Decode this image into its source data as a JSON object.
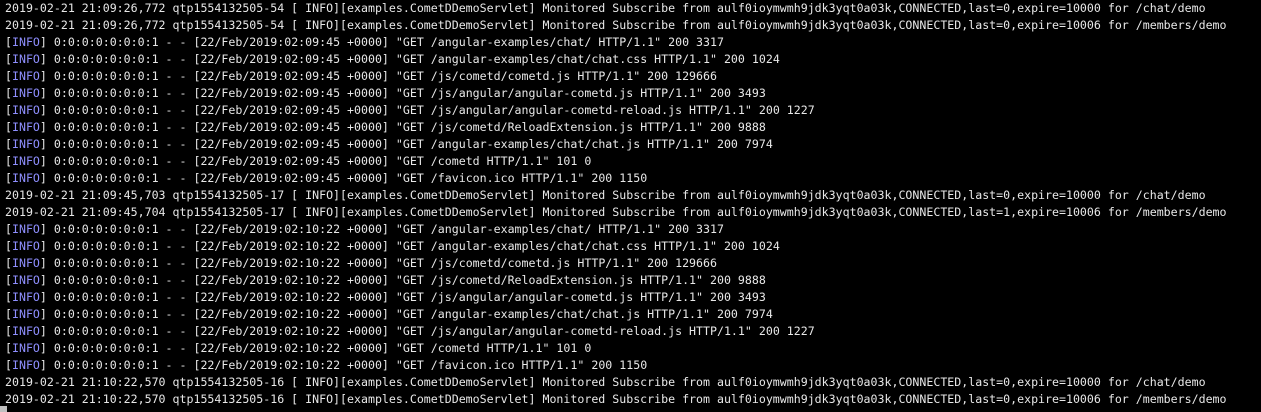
{
  "terminal": {
    "colors": {
      "background": "#000000",
      "text": "#e8e8e8",
      "info_tag": "#8f8fff"
    },
    "lines": [
      {
        "kind": "servlet",
        "text": "2019-02-21 21:09:26,772 qtp1554132505-54 [ INFO][examples.CometDDemoServlet] Monitored Subscribe from aulf0ioymwmh9jdk3yqt0a03k,CONNECTED,last=0,expire=10000 for /chat/demo"
      },
      {
        "kind": "servlet",
        "text": "2019-02-21 21:09:26,772 qtp1554132505-54 [ INFO][examples.CometDDemoServlet] Monitored Subscribe from aulf0ioymwmh9jdk3yqt0a03k,CONNECTED,last=0,expire=10006 for /members/demo"
      },
      {
        "kind": "access",
        "level": "INFO",
        "text": " 0:0:0:0:0:0:0:1 - - [22/Feb/2019:02:09:45 +0000] \"GET /angular-examples/chat/ HTTP/1.1\" 200 3317"
      },
      {
        "kind": "access",
        "level": "INFO",
        "text": " 0:0:0:0:0:0:0:1 - - [22/Feb/2019:02:09:45 +0000] \"GET /angular-examples/chat/chat.css HTTP/1.1\" 200 1024"
      },
      {
        "kind": "access",
        "level": "INFO",
        "text": " 0:0:0:0:0:0:0:1 - - [22/Feb/2019:02:09:45 +0000] \"GET /js/cometd/cometd.js HTTP/1.1\" 200 129666"
      },
      {
        "kind": "access",
        "level": "INFO",
        "text": " 0:0:0:0:0:0:0:1 - - [22/Feb/2019:02:09:45 +0000] \"GET /js/angular/angular-cometd.js HTTP/1.1\" 200 3493"
      },
      {
        "kind": "access",
        "level": "INFO",
        "text": " 0:0:0:0:0:0:0:1 - - [22/Feb/2019:02:09:45 +0000] \"GET /js/angular/angular-cometd-reload.js HTTP/1.1\" 200 1227"
      },
      {
        "kind": "access",
        "level": "INFO",
        "text": " 0:0:0:0:0:0:0:1 - - [22/Feb/2019:02:09:45 +0000] \"GET /js/cometd/ReloadExtension.js HTTP/1.1\" 200 9888"
      },
      {
        "kind": "access",
        "level": "INFO",
        "text": " 0:0:0:0:0:0:0:1 - - [22/Feb/2019:02:09:45 +0000] \"GET /angular-examples/chat/chat.js HTTP/1.1\" 200 7974"
      },
      {
        "kind": "access",
        "level": "INFO",
        "text": " 0:0:0:0:0:0:0:1 - - [22/Feb/2019:02:09:45 +0000] \"GET /cometd HTTP/1.1\" 101 0"
      },
      {
        "kind": "access",
        "level": "INFO",
        "text": " 0:0:0:0:0:0:0:1 - - [22/Feb/2019:02:09:45 +0000] \"GET /favicon.ico HTTP/1.1\" 200 1150"
      },
      {
        "kind": "servlet",
        "text": "2019-02-21 21:09:45,703 qtp1554132505-17 [ INFO][examples.CometDDemoServlet] Monitored Subscribe from aulf0ioymwmh9jdk3yqt0a03k,CONNECTED,last=0,expire=10000 for /chat/demo"
      },
      {
        "kind": "servlet",
        "text": "2019-02-21 21:09:45,704 qtp1554132505-17 [ INFO][examples.CometDDemoServlet] Monitored Subscribe from aulf0ioymwmh9jdk3yqt0a03k,CONNECTED,last=1,expire=10006 for /members/demo"
      },
      {
        "kind": "access",
        "level": "INFO",
        "text": " 0:0:0:0:0:0:0:1 - - [22/Feb/2019:02:10:22 +0000] \"GET /angular-examples/chat/ HTTP/1.1\" 200 3317"
      },
      {
        "kind": "access",
        "level": "INFO",
        "text": " 0:0:0:0:0:0:0:1 - - [22/Feb/2019:02:10:22 +0000] \"GET /angular-examples/chat/chat.css HTTP/1.1\" 200 1024"
      },
      {
        "kind": "access",
        "level": "INFO",
        "text": " 0:0:0:0:0:0:0:1 - - [22/Feb/2019:02:10:22 +0000] \"GET /js/cometd/cometd.js HTTP/1.1\" 200 129666"
      },
      {
        "kind": "access",
        "level": "INFO",
        "text": " 0:0:0:0:0:0:0:1 - - [22/Feb/2019:02:10:22 +0000] \"GET /js/cometd/ReloadExtension.js HTTP/1.1\" 200 9888"
      },
      {
        "kind": "access",
        "level": "INFO",
        "text": " 0:0:0:0:0:0:0:1 - - [22/Feb/2019:02:10:22 +0000] \"GET /js/angular/angular-cometd.js HTTP/1.1\" 200 3493"
      },
      {
        "kind": "access",
        "level": "INFO",
        "text": " 0:0:0:0:0:0:0:1 - - [22/Feb/2019:02:10:22 +0000] \"GET /angular-examples/chat/chat.js HTTP/1.1\" 200 7974"
      },
      {
        "kind": "access",
        "level": "INFO",
        "text": " 0:0:0:0:0:0:0:1 - - [22/Feb/2019:02:10:22 +0000] \"GET /js/angular/angular-cometd-reload.js HTTP/1.1\" 200 1227"
      },
      {
        "kind": "access",
        "level": "INFO",
        "text": " 0:0:0:0:0:0:0:1 - - [22/Feb/2019:02:10:22 +0000] \"GET /cometd HTTP/1.1\" 101 0"
      },
      {
        "kind": "access",
        "level": "INFO",
        "text": " 0:0:0:0:0:0:0:1 - - [22/Feb/2019:02:10:22 +0000] \"GET /favicon.ico HTTP/1.1\" 200 1150"
      },
      {
        "kind": "servlet",
        "text": "2019-02-21 21:10:22,570 qtp1554132505-16 [ INFO][examples.CometDDemoServlet] Monitored Subscribe from aulf0ioymwmh9jdk3yqt0a03k,CONNECTED,last=0,expire=10000 for /chat/demo"
      },
      {
        "kind": "servlet",
        "text": "2019-02-21 21:10:22,570 qtp1554132505-16 [ INFO][examples.CometDDemoServlet] Monitored Subscribe from aulf0ioymwmh9jdk3yqt0a03k,CONNECTED,last=0,expire=10006 for /members/demo"
      }
    ]
  }
}
